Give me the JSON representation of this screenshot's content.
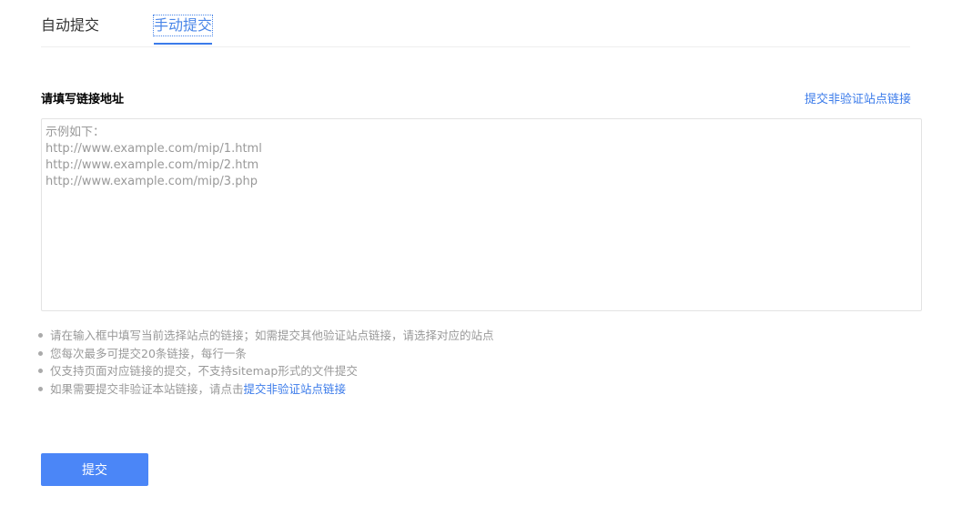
{
  "tabs": {
    "auto": "自动提交",
    "manual": "手动提交"
  },
  "form": {
    "title": "请填写链接地址",
    "alt_link": "提交非验证站点链接",
    "textarea_placeholder": "示例如下：\nhttp://www.example.com/mip/1.html\nhttp://www.example.com/mip/2.htm\nhttp://www.example.com/mip/3.php",
    "textarea_value": ""
  },
  "tips": [
    {
      "text": "请在输入框中填写当前选择站点的链接；如需提交其他验证站点链接，请选择对应的站点"
    },
    {
      "text": "您每次最多可提交20条链接，每行一条"
    },
    {
      "text": "仅支持页面对应链接的提交，不支持sitemap形式的文件提交"
    },
    {
      "text": "如果需要提交非验证本站链接，请点击",
      "link": "提交非验证站点链接"
    }
  ],
  "submit_label": "提交",
  "colors": {
    "accent": "#3b7bea",
    "button": "#4b86f7",
    "muted": "#999999"
  }
}
